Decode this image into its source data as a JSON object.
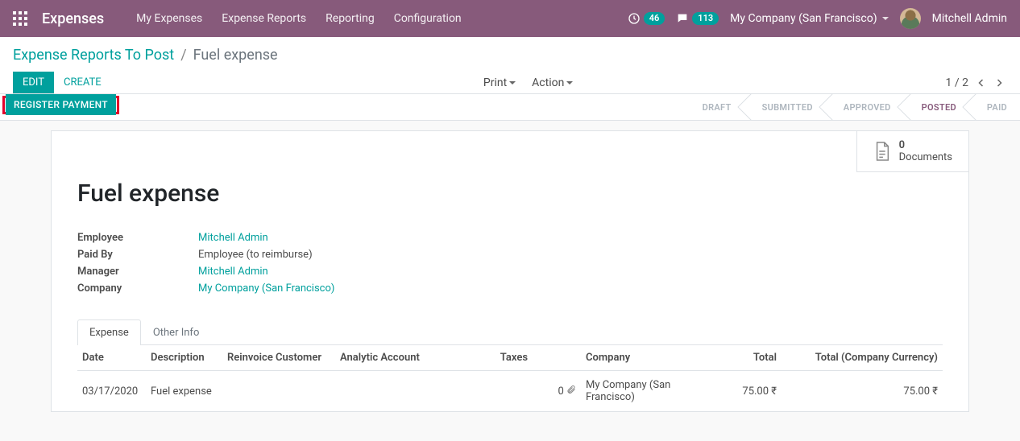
{
  "topbar": {
    "brand": "Expenses",
    "nav": [
      "My Expenses",
      "Expense Reports",
      "Reporting",
      "Configuration"
    ],
    "clock_count": "46",
    "chat_count": "113",
    "company": "My Company (San Francisco)",
    "user": "Mitchell Admin"
  },
  "breadcrumb": {
    "parent": "Expense Reports To Post",
    "current": "Fuel expense"
  },
  "controls": {
    "edit": "Edit",
    "create": "Create",
    "print": "Print",
    "action": "Action",
    "pager": "1 / 2"
  },
  "statusbar": {
    "register_payment": "Register Payment",
    "stages": {
      "draft": "DRAFT",
      "submitted": "SUBMITTED",
      "approved": "APPROVED",
      "posted": "POSTED",
      "paid": "PAID"
    }
  },
  "documents": {
    "count": "0",
    "label": "Documents"
  },
  "record": {
    "title": "Fuel expense",
    "labels": {
      "employee": "Employee",
      "paid_by": "Paid By",
      "manager": "Manager",
      "company": "Company"
    },
    "employee": "Mitchell Admin",
    "paid_by": "Employee (to reimburse)",
    "manager": "Mitchell Admin",
    "company": "My Company (San Francisco)"
  },
  "tabs": {
    "expense": "Expense",
    "other": "Other Info"
  },
  "table": {
    "headers": {
      "date": "Date",
      "description": "Description",
      "reinvoice": "Reinvoice Customer",
      "analytic": "Analytic Account",
      "taxes": "Taxes",
      "company": "Company",
      "total": "Total",
      "total_cc": "Total (Company Currency)"
    },
    "row": {
      "date": "03/17/2020",
      "description": "Fuel expense",
      "attach_count": "0",
      "company": "My Company (San Francisco)",
      "total": "75.00 ₹",
      "total_cc": "75.00 ₹"
    }
  }
}
